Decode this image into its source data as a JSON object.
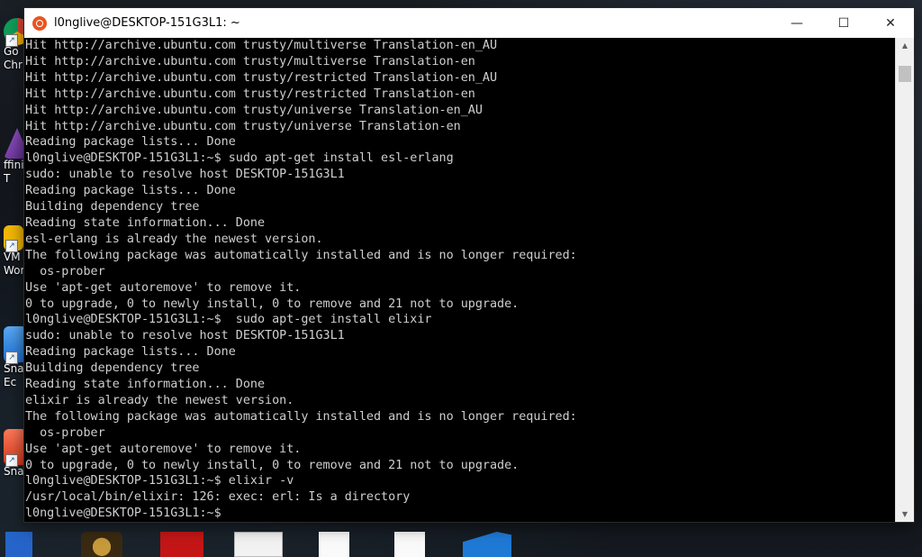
{
  "window": {
    "title": "l0nglive@DESKTOP-151G3L1: ~",
    "minimize_glyph": "—",
    "maximize_glyph": "☐",
    "close_glyph": "✕"
  },
  "terminal": {
    "lines": [
      "Hit http://archive.ubuntu.com trusty/multiverse Translation-en_AU",
      "Hit http://archive.ubuntu.com trusty/multiverse Translation-en",
      "Hit http://archive.ubuntu.com trusty/restricted Translation-en_AU",
      "Hit http://archive.ubuntu.com trusty/restricted Translation-en",
      "Hit http://archive.ubuntu.com trusty/universe Translation-en_AU",
      "Hit http://archive.ubuntu.com trusty/universe Translation-en",
      "Reading package lists... Done",
      "l0nglive@DESKTOP-151G3L1:~$ sudo apt-get install esl-erlang",
      "sudo: unable to resolve host DESKTOP-151G3L1",
      "Reading package lists... Done",
      "Building dependency tree",
      "Reading state information... Done",
      "esl-erlang is already the newest version.",
      "The following package was automatically installed and is no longer required:",
      "  os-prober",
      "Use 'apt-get autoremove' to remove it.",
      "0 to upgrade, 0 to newly install, 0 to remove and 21 not to upgrade.",
      "l0nglive@DESKTOP-151G3L1:~$  sudo apt-get install elixir",
      "sudo: unable to resolve host DESKTOP-151G3L1",
      "Reading package lists... Done",
      "Building dependency tree",
      "Reading state information... Done",
      "elixir is already the newest version.",
      "The following package was automatically installed and is no longer required:",
      "  os-prober",
      "Use 'apt-get autoremove' to remove it.",
      "0 to upgrade, 0 to newly install, 0 to remove and 21 not to upgrade.",
      "l0nglive@DESKTOP-151G3L1:~$ elixir -v",
      "/usr/local/bin/elixir: 126: exec: erl: Is a directory",
      "l0nglive@DESKTOP-151G3L1:~$ "
    ]
  },
  "desktop": {
    "icons": [
      {
        "label1": "Go",
        "label2": "Chr",
        "color": "#db4437",
        "icon": "chrome-icon"
      },
      {
        "label1": "ffinit",
        "label2": "T",
        "color": "#7b3fb6",
        "icon": "affinity-icon"
      },
      {
        "label1": "VM",
        "label2": "Work",
        "color": "#f2b705",
        "icon": "vmware-icon"
      },
      {
        "label1": "Sna",
        "label2": "Ec",
        "color": "#2f80ed",
        "icon": "snagit-editor-icon"
      },
      {
        "label1": "Sna",
        "label2": "",
        "color": "#e8502e",
        "icon": "snagit-icon"
      }
    ]
  }
}
